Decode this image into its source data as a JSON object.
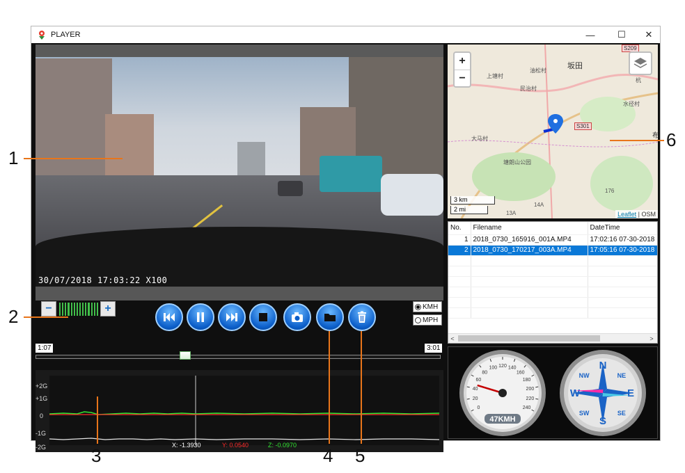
{
  "window": {
    "title": "PLAYER",
    "controls": {
      "minimize": "—",
      "maximize": "☐",
      "close": "✕"
    }
  },
  "video": {
    "osd_text": "30/07/2018 17:03:22 X100"
  },
  "volume": {
    "minus_label": "−",
    "plus_label": "+",
    "level": 1.0
  },
  "playback": {
    "buttons": [
      "previous",
      "pause",
      "next",
      "stop",
      "snapshot",
      "open-folder",
      "delete"
    ],
    "current_time": "1:07",
    "total_time": "3:01",
    "position": 0.37
  },
  "speed_units": {
    "options": [
      {
        "label": "KMH",
        "selected": true
      },
      {
        "label": "MPH",
        "selected": false
      }
    ]
  },
  "gsensor": {
    "y_labels": [
      "+2G",
      "+1G",
      "0",
      "-1G",
      "-2G"
    ],
    "readout": {
      "x": "X: -1.3930",
      "y": "Y: 0.0540",
      "z": "Z: -0.0970"
    },
    "colors": {
      "x": "#e6e6e6",
      "y": "#ff2a2a",
      "z": "#33e633"
    }
  },
  "map": {
    "zoom_in": "+",
    "zoom_out": "−",
    "scale_km": "3 km",
    "scale_mi": "2 mi",
    "attribution_link": "Leaflet",
    "attribution_sep": " | ",
    "attribution_osm": "OSM",
    "labels": [
      "坂田",
      "油松村",
      "上塘村",
      "民治村",
      "大马村",
      "塘朗山公园",
      "水径村",
      "S301",
      "S209",
      "布",
      "杭",
      "176",
      "13A",
      "14A"
    ]
  },
  "file_list": {
    "columns": [
      "No.",
      "Filename",
      "DateTime"
    ],
    "rows": [
      {
        "no": "1",
        "filename": "2018_0730_165916_001A.MP4",
        "datetime": "17:02:16 07-30-2018",
        "selected": false
      },
      {
        "no": "2",
        "filename": "2018_0730_170217_003A.MP4",
        "datetime": "17:05:16 07-30-2018",
        "selected": true
      }
    ],
    "scroll_left": "<",
    "scroll_right": ">"
  },
  "speedometer": {
    "ticks": [
      "0",
      "20",
      "40",
      "60",
      "80",
      "100",
      "120",
      "140",
      "160",
      "180",
      "200",
      "220",
      "240"
    ],
    "readout": "47KMH",
    "speed": 47
  },
  "compass": {
    "labels": [
      "N",
      "NE",
      "E",
      "SE",
      "S",
      "SW",
      "W",
      "NW"
    ],
    "heading_deg": 275
  },
  "callouts": [
    "1",
    "2",
    "3",
    "4",
    "5",
    "6"
  ],
  "colors": {
    "accent": "#0a78d7",
    "callout_line": "#e8751a"
  }
}
